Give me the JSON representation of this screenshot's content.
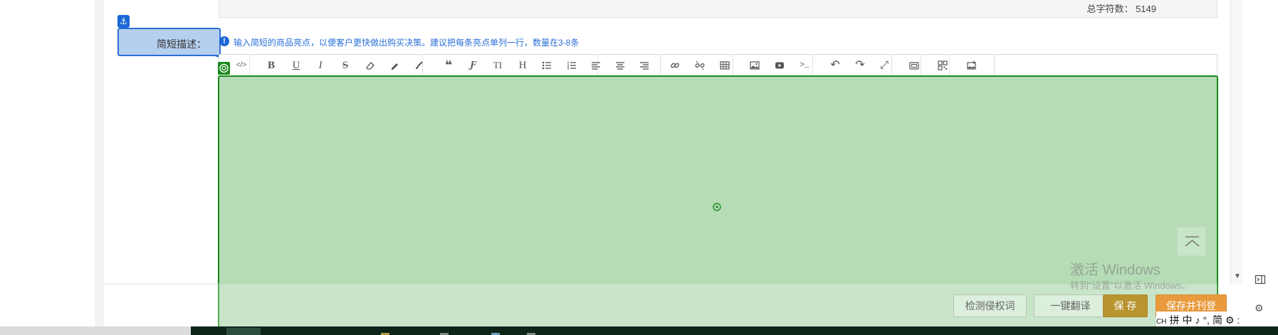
{
  "top_area": {
    "char_count_label": "总字符数：",
    "char_count_value": "5149"
  },
  "field": {
    "label": "简短描述：",
    "hint": "输入简短的商品亮点，以便客户更快做出购买决策。建议把每条亮点单列一行，数量在3-8条"
  },
  "toolbar": {
    "buttons": [
      {
        "name": "source-code",
        "glyph": "</>"
      },
      {
        "name": "bold",
        "glyph": "B"
      },
      {
        "name": "underline",
        "glyph": "U"
      },
      {
        "name": "italic",
        "glyph": "I"
      },
      {
        "name": "strikethrough",
        "glyph": "S"
      },
      {
        "name": "eraser",
        "glyph": ""
      },
      {
        "name": "pencil",
        "glyph": ""
      },
      {
        "name": "brush",
        "glyph": ""
      },
      {
        "name": "quote",
        "glyph": "❝"
      },
      {
        "name": "font-family",
        "glyph": "Ƒ"
      },
      {
        "name": "font-size",
        "glyph": "TI"
      },
      {
        "name": "heading",
        "glyph": "H"
      },
      {
        "name": "bulleted-list",
        "glyph": ""
      },
      {
        "name": "numbered-list",
        "glyph": ""
      },
      {
        "name": "align-left",
        "glyph": ""
      },
      {
        "name": "align-center",
        "glyph": ""
      },
      {
        "name": "align-right",
        "glyph": ""
      },
      {
        "name": "link",
        "glyph": ""
      },
      {
        "name": "unlink",
        "glyph": ""
      },
      {
        "name": "table",
        "glyph": ""
      },
      {
        "name": "image",
        "glyph": ""
      },
      {
        "name": "video",
        "glyph": ""
      },
      {
        "name": "code",
        "glyph": ">_"
      },
      {
        "name": "undo",
        "glyph": "↶"
      },
      {
        "name": "redo",
        "glyph": "↷"
      },
      {
        "name": "fullscreen",
        "glyph": "⤢"
      },
      {
        "name": "image-gallery",
        "glyph": ""
      },
      {
        "name": "qr-code",
        "glyph": ""
      },
      {
        "name": "image-edit",
        "glyph": ""
      }
    ]
  },
  "actions": {
    "check_label": "检测侵权词",
    "translate_label": "一键翻译",
    "save_label": "保 存",
    "save_publish_label": "保存并刊登"
  },
  "watermark": {
    "title": "激活 Windows",
    "subtitle": "转到\"设置\"以激活 Windows。"
  },
  "ime": {
    "items": [
      "CH",
      "拼",
      "中",
      "♪",
      "°,",
      "简",
      "⚙",
      ":"
    ]
  },
  "colors": {
    "editor_fill": "#b5dcb5",
    "editor_border": "#1a8a1a",
    "label_fill": "#b5cfee",
    "accent_blue": "#1b67d6",
    "save": "#b99530",
    "save_publish": "#e89a3c"
  }
}
